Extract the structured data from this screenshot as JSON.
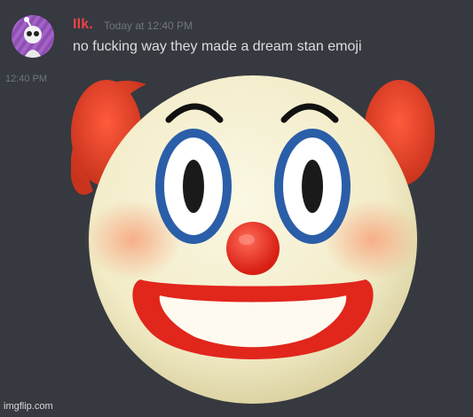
{
  "message": {
    "username": "Ilk.",
    "timestamp": "Today at 12:40 PM",
    "text": "no fucking way they made a dream stan emoji",
    "hover_time": "12:40 PM",
    "avatar_icon": "purple-alien-avatar-icon"
  },
  "attachment": {
    "icon": "clown-face-emoji"
  },
  "watermark": {
    "text": "imgflip.com"
  },
  "colors": {
    "background": "#36393f",
    "username": "#ed4245",
    "message_text": "#dcddde",
    "timestamp": "#72767d"
  }
}
